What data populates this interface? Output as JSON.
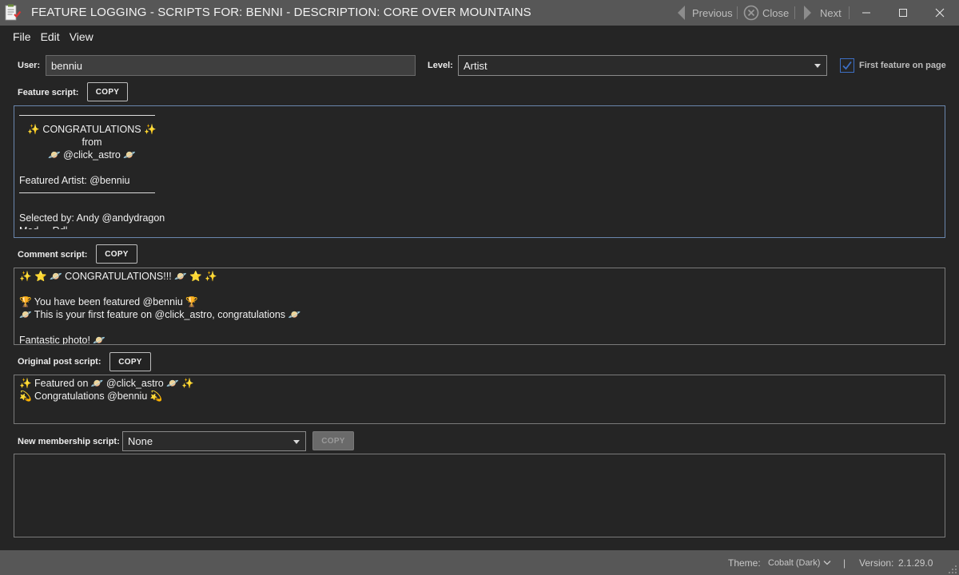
{
  "window": {
    "title": "FEATURE LOGGING - SCRIPTS FOR: BENNI - DESCRIPTION: CORE OVER MOUNTAINS",
    "nav": {
      "previous": "Previous",
      "close": "Close",
      "next": "Next"
    }
  },
  "menu": {
    "file": "File",
    "edit": "Edit",
    "view": "View"
  },
  "form": {
    "user_label": "User:",
    "user_value": "benniu",
    "level_label": "Level:",
    "level_value": "Artist",
    "first_feature_label": "First feature on page",
    "first_feature_checked": true
  },
  "feature": {
    "label": "Feature script:",
    "copy": "COPY",
    "congrats": "✨ CONGRATULATIONS ✨",
    "from": "from",
    "handle": "🪐 @click_astro 🪐",
    "artist": "Featured Artist: @benniu",
    "selected_by": "Selected by: Andy @andydragon",
    "cut_line": "Mod ... Rdl"
  },
  "comment": {
    "label": "Comment script:",
    "copy": "COPY",
    "lines": [
      "✨ ⭐ 🪐 CONGRATULATIONS!!! 🪐 ⭐ ✨",
      "",
      "🏆 You have been featured @benniu 🏆",
      "🪐 This is your first feature on @click_astro, congratulations 🪐",
      "",
      "Fantastic photo! 🪐"
    ]
  },
  "original": {
    "label": "Original post script:",
    "copy": "COPY",
    "lines": [
      "✨ Featured on 🪐 @click_astro 🪐 ✨",
      "💫 Congratulations @benniu 💫"
    ]
  },
  "membership": {
    "label": "New membership script:",
    "value": "None",
    "copy": "COPY"
  },
  "status": {
    "theme_label": "Theme:",
    "theme_value": "Cobalt (Dark)",
    "separator": "|",
    "version_label": "Version:",
    "version_value": "2.1.29.0"
  },
  "colors": {
    "accent": "#3d6fc4",
    "titlebar": "#575757",
    "background": "#252525"
  }
}
